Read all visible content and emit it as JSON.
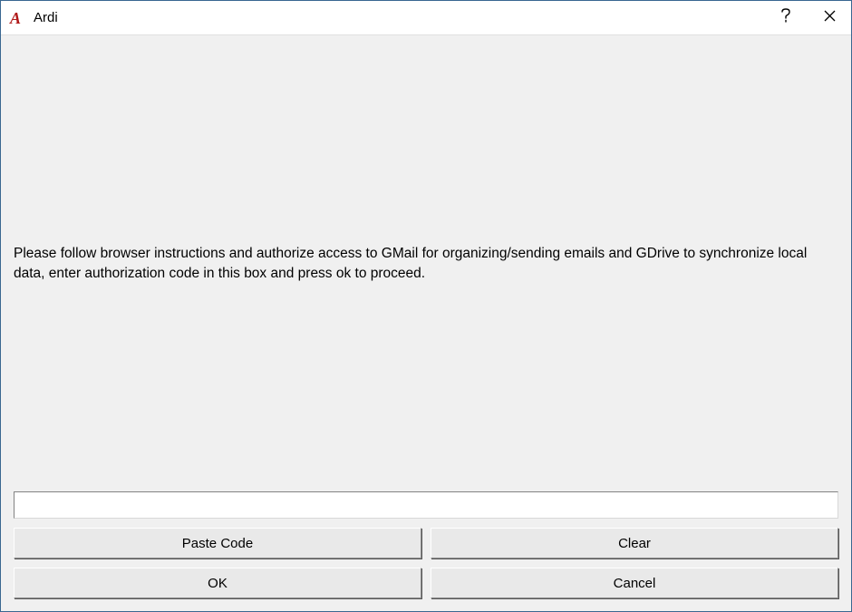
{
  "titlebar": {
    "app_icon_letter": "A",
    "title": "Ardi"
  },
  "main": {
    "instruction": "Please follow browser instructions and authorize access to GMail for organizing/sending emails and GDrive to synchronize local data, enter authorization code in this box and press ok to proceed.",
    "code_value": "",
    "code_placeholder": ""
  },
  "buttons": {
    "paste_code": "Paste Code",
    "clear": "Clear",
    "ok": "OK",
    "cancel": "Cancel"
  }
}
